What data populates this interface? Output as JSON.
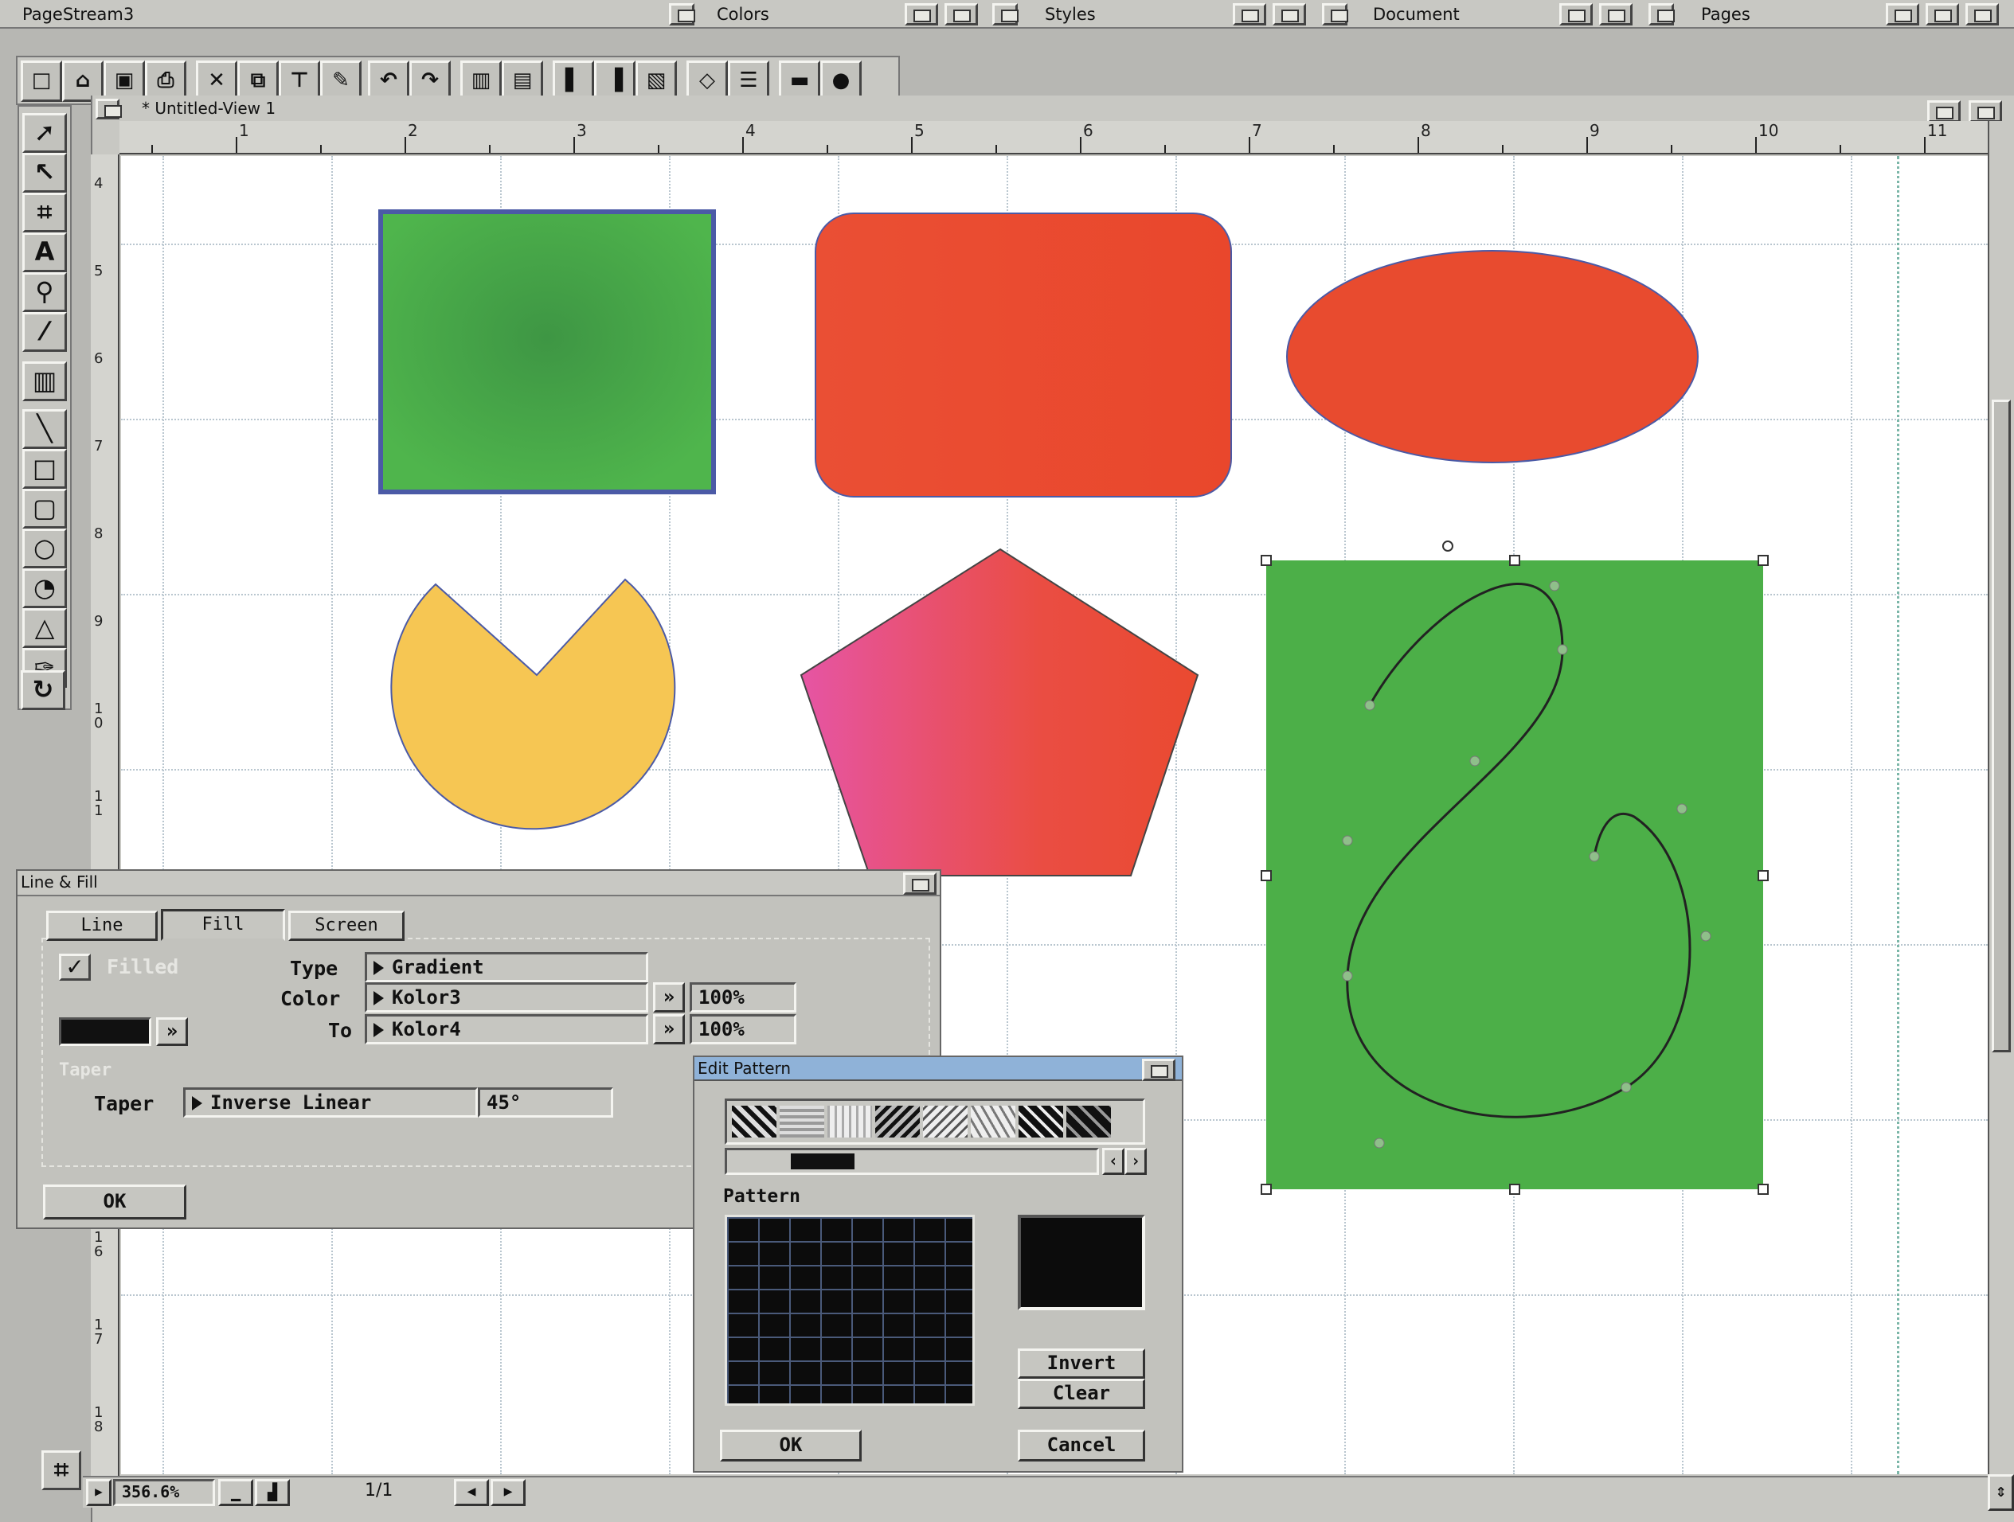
{
  "app": {
    "title": "PageStream3"
  },
  "panels": {
    "colors": "Colors",
    "styles": "Styles",
    "document": "Document",
    "pages": "Pages"
  },
  "view": {
    "title": "* Untitled-View 1"
  },
  "rulers": {
    "h": [
      "1",
      "2",
      "3",
      "4",
      "5",
      "6",
      "7",
      "8",
      "9",
      "10",
      "11"
    ],
    "v": [
      "4",
      "5",
      "6",
      "7",
      "8",
      "9",
      "10",
      "11",
      "16",
      "17",
      "18"
    ]
  },
  "status": {
    "zoom": "356.6%",
    "page": "1/1"
  },
  "linefill": {
    "title": "Line & Fill",
    "tabs": [
      "Line",
      "Fill",
      "Screen"
    ],
    "filled": "Filled",
    "type_label": "Type",
    "type_value": "Gradient",
    "color_label": "Color",
    "color_value": "Kolor3",
    "color_pct": "100%",
    "to_label": "To",
    "to_value": "Kolor4",
    "to_pct": "100%",
    "taper_section": "Taper",
    "taper_label": "Taper",
    "taper_value": "Inverse Linear",
    "taper_angle": "45°",
    "ok": "OK",
    "more": "»"
  },
  "editpattern": {
    "title": "Edit Pattern",
    "pattern_label": "Pattern",
    "invert": "Invert",
    "clear": "Clear",
    "ok": "OK",
    "cancel": "Cancel"
  },
  "colors": {
    "green": "#4caf48",
    "red": "#e84a30",
    "yellow": "#f6c653",
    "pink": "#e8559c",
    "outline": "#4b5aa6",
    "chrome": "#c2c2bd"
  }
}
